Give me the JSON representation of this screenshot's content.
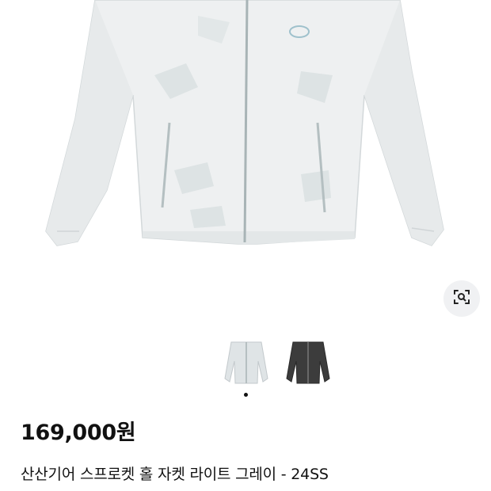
{
  "product": {
    "image_alt": "jacket-photo",
    "price": "169,000원",
    "title": "산산기어 스프로켓 홀 자켓 라이트 그레이 - 24SS",
    "subtitle": ""
  },
  "gallery": {
    "thumbnails": [
      {
        "name": "light-gray",
        "color": "#dfe4e6"
      },
      {
        "name": "charcoal",
        "color": "#3c3c3c"
      }
    ],
    "active_index": 0
  },
  "icons": {
    "lens": "image-search-icon"
  }
}
